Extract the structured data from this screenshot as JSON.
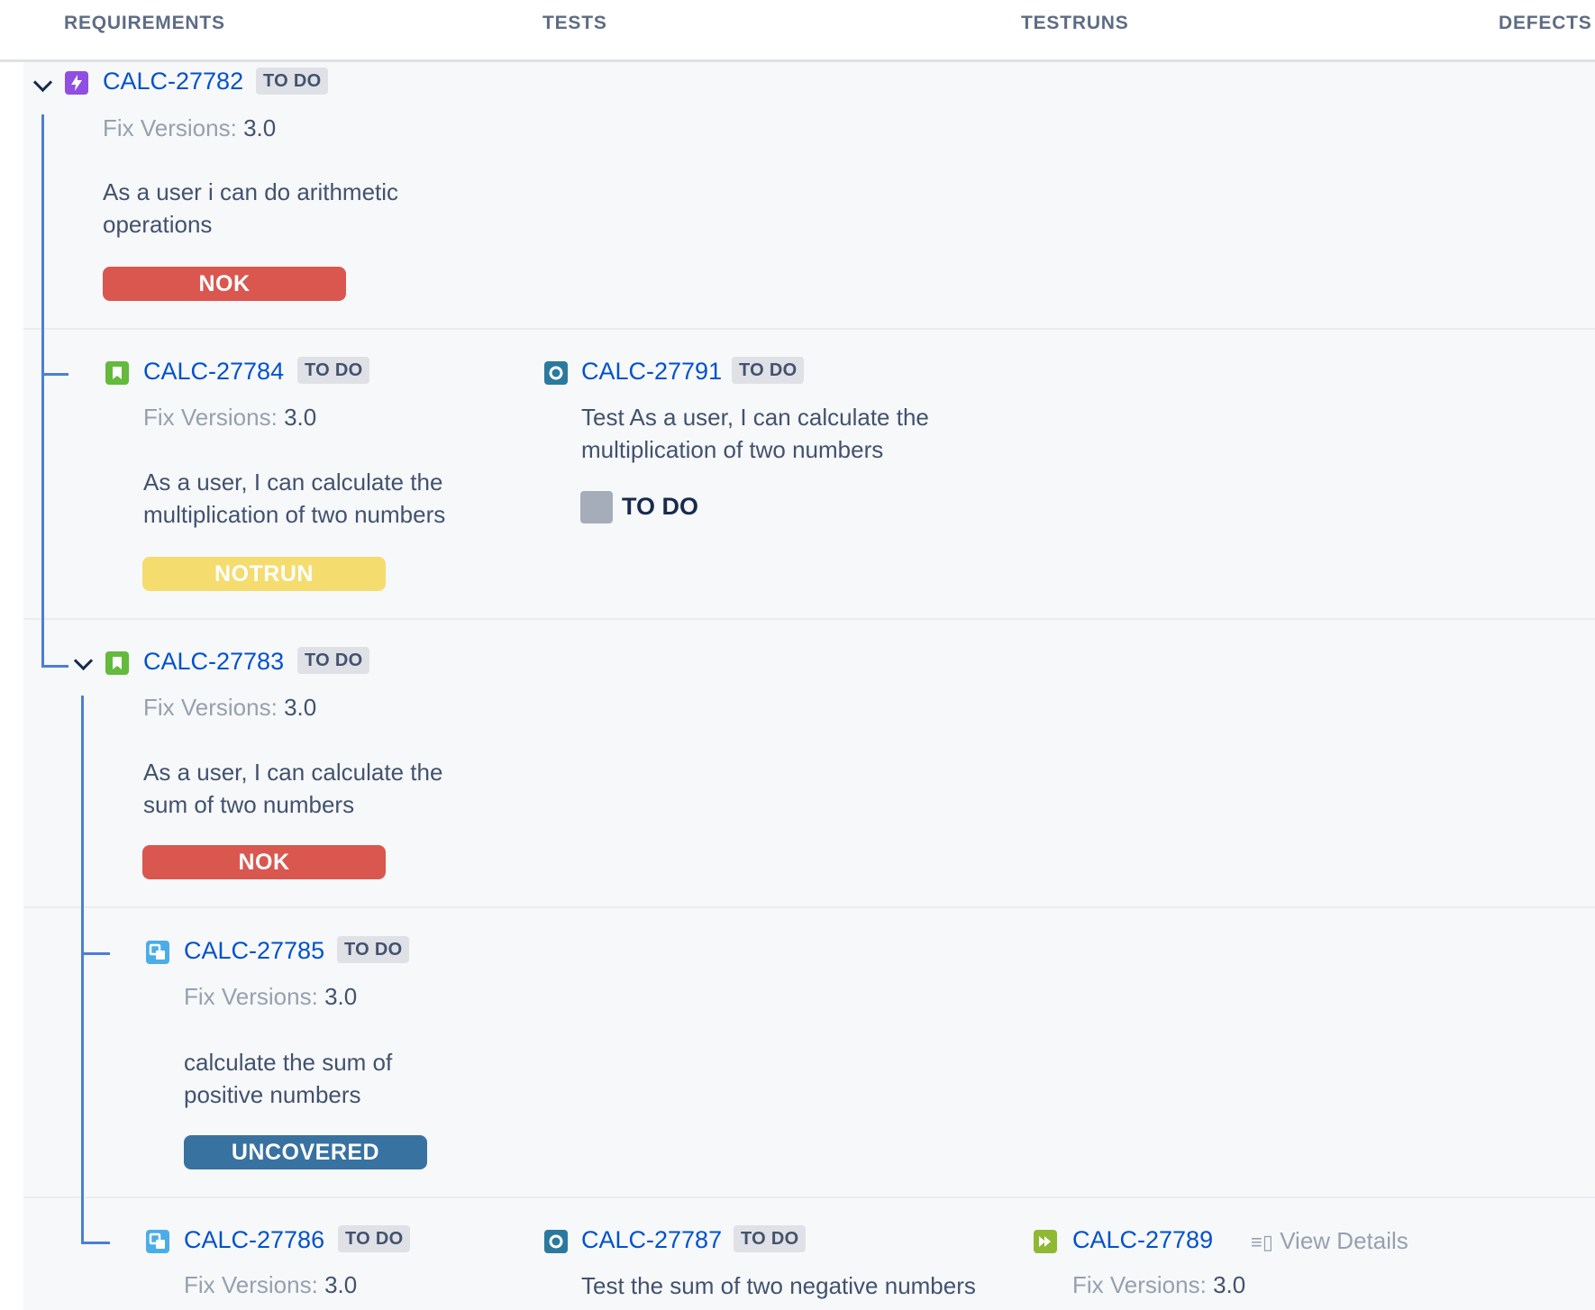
{
  "columns": {
    "requirements": "REQUIREMENTS",
    "tests": "TESTS",
    "testruns": "TESTRUNS",
    "defects": "DEFECTS"
  },
  "labels": {
    "fix_versions": "Fix Versions:"
  },
  "colors": {
    "epic": "#904ee2",
    "story": "#63ba3c",
    "subtask": "#4bade8",
    "test": "#2b7a9e",
    "testrun": "#8fb833",
    "nok": "#d9574f",
    "notrun": "#f4dc6f",
    "uncovered": "#3872a1",
    "tree_line": "#4c7ed8"
  },
  "rows": [
    {
      "key": "CALC-27782",
      "status": "TO DO",
      "icon": "epic-icon",
      "fix_version": "3.0",
      "summary": "As a user i can do arithmetic operations",
      "coverage": "NOK",
      "expanded": true
    },
    {
      "key": "CALC-27784",
      "status": "TO DO",
      "icon": "story-icon",
      "fix_version": "3.0",
      "summary": "As a user, I can calculate the multiplication of two numbers",
      "coverage": "NOTRUN",
      "test": {
        "key": "CALC-27791",
        "status": "TO DO",
        "icon": "test-icon",
        "summary": "Test As a user, I can calculate the multiplication of two numbers",
        "run_status": "TO DO"
      }
    },
    {
      "key": "CALC-27783",
      "status": "TO DO",
      "icon": "story-icon",
      "fix_version": "3.0",
      "summary": "As a user, I can calculate the sum of two numbers",
      "coverage": "NOK",
      "expanded": true
    },
    {
      "key": "CALC-27785",
      "status": "TO DO",
      "icon": "subtask-icon",
      "fix_version": "3.0",
      "summary": "calculate the sum of positive numbers",
      "coverage": "UNCOVERED"
    },
    {
      "key": "CALC-27786",
      "status": "TO DO",
      "icon": "subtask-icon",
      "fix_version": "3.0",
      "test": {
        "key": "CALC-27787",
        "status": "TO DO",
        "icon": "test-icon",
        "summary": "Test the sum of two negative numbers"
      },
      "testrun": {
        "key": "CALC-27789",
        "icon": "testrun-icon",
        "view_details": "View Details",
        "fix_version": "3.0"
      }
    }
  ]
}
